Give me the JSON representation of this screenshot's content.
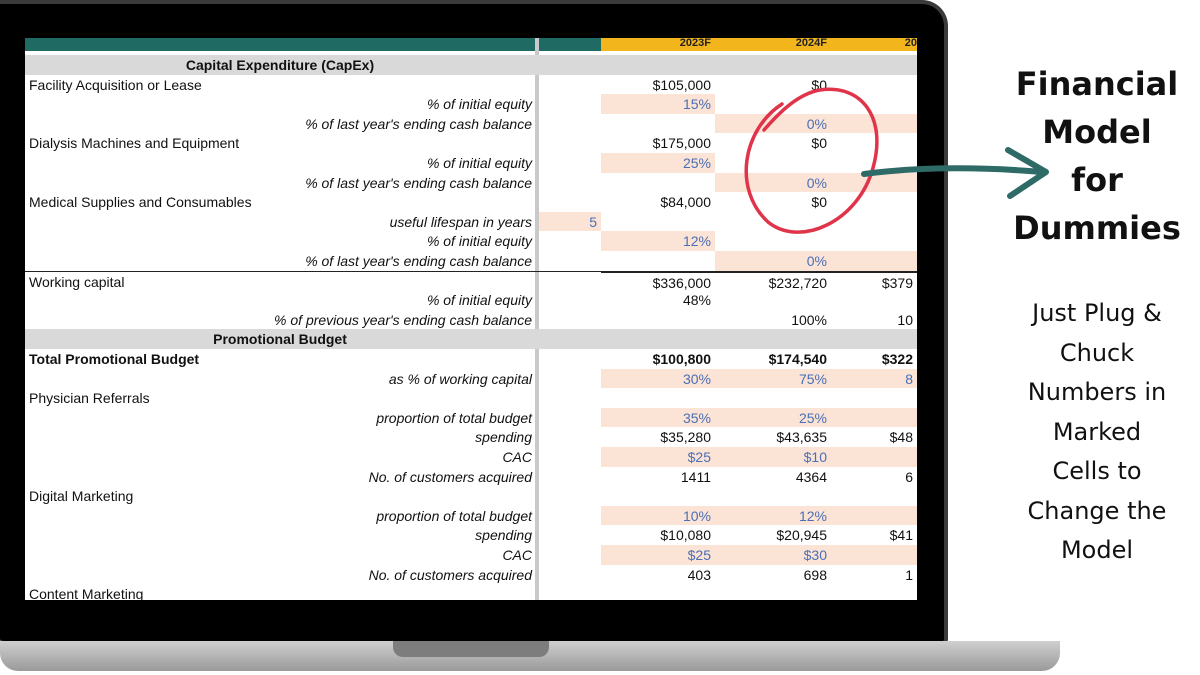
{
  "years": [
    "2023F",
    "2024F",
    "20"
  ],
  "rows": [
    {
      "type": "section",
      "label": "Capital Expenditure (CapEx)"
    },
    {
      "type": "main",
      "label": "Facility Acquisition or Lease",
      "v": [
        "$105,000",
        "$0",
        ""
      ]
    },
    {
      "type": "sub",
      "label": "% of initial equity",
      "v": [
        "15%",
        "",
        ""
      ],
      "inp": [
        true,
        false,
        false
      ]
    },
    {
      "type": "sub",
      "label": "% of last year's ending cash balance",
      "v": [
        "",
        "0%",
        ""
      ],
      "inp": [
        false,
        true,
        true
      ]
    },
    {
      "type": "main",
      "label": "Dialysis Machines and Equipment",
      "v": [
        "$175,000",
        "$0",
        ""
      ]
    },
    {
      "type": "sub",
      "label": "% of initial equity",
      "v": [
        "25%",
        "",
        ""
      ],
      "inp": [
        true,
        false,
        false
      ]
    },
    {
      "type": "sub",
      "label": "% of last year's ending cash balance",
      "v": [
        "",
        "0%",
        ""
      ],
      "inp": [
        false,
        true,
        true
      ]
    },
    {
      "type": "main",
      "label": "Medical Supplies and Consumables",
      "v": [
        "$84,000",
        "$0",
        ""
      ]
    },
    {
      "type": "sub",
      "label": "useful lifespan in years",
      "x": "5",
      "v": [
        "",
        "",
        ""
      ],
      "inp": [
        false,
        false,
        false
      ]
    },
    {
      "type": "sub",
      "label": "% of initial equity",
      "v": [
        "12%",
        "",
        ""
      ],
      "inp": [
        true,
        false,
        false
      ]
    },
    {
      "type": "sub",
      "label": "% of last year's ending cash balance",
      "v": [
        "",
        "0%",
        ""
      ],
      "inp": [
        false,
        true,
        true
      ]
    },
    {
      "type": "main",
      "label": "Working capital",
      "v": [
        "$336,000",
        "$232,720",
        "$379"
      ],
      "line": true
    },
    {
      "type": "sub",
      "label": "% of initial equity",
      "v": [
        "48%",
        "",
        ""
      ],
      "inp": [
        false,
        false,
        false
      ]
    },
    {
      "type": "sub",
      "label": "% of previous year's ending cash balance",
      "v": [
        "",
        "100%",
        "10"
      ],
      "inp": [
        false,
        false,
        false
      ]
    },
    {
      "type": "section",
      "label": "Promotional Budget"
    },
    {
      "type": "main",
      "bold": true,
      "label": "Total Promotional Budget",
      "v": [
        "$100,800",
        "$174,540",
        "$322"
      ]
    },
    {
      "type": "sub",
      "label": "as % of working capital",
      "v": [
        "30%",
        "75%",
        "8"
      ],
      "inp": [
        true,
        true,
        true
      ]
    },
    {
      "type": "main",
      "label": "Physician Referrals",
      "v": [
        "",
        "",
        ""
      ]
    },
    {
      "type": "sub",
      "label": "proportion of total budget",
      "v": [
        "35%",
        "25%",
        ""
      ],
      "inp": [
        true,
        true,
        true
      ]
    },
    {
      "type": "sub",
      "label": "spending",
      "v": [
        "$35,280",
        "$43,635",
        "$48"
      ],
      "inp": [
        false,
        false,
        false
      ]
    },
    {
      "type": "sub",
      "label": "CAC",
      "v": [
        "$25",
        "$10",
        ""
      ],
      "inp": [
        true,
        true,
        true
      ]
    },
    {
      "type": "sub",
      "label": "No. of customers acquired",
      "v": [
        "1411",
        "4364",
        "6"
      ],
      "inp": [
        false,
        false,
        false
      ]
    },
    {
      "type": "main",
      "label": "Digital Marketing",
      "v": [
        "",
        "",
        ""
      ]
    },
    {
      "type": "sub",
      "label": "proportion of total budget",
      "v": [
        "10%",
        "12%",
        ""
      ],
      "inp": [
        true,
        true,
        true
      ]
    },
    {
      "type": "sub",
      "label": "spending",
      "v": [
        "$10,080",
        "$20,945",
        "$41"
      ],
      "inp": [
        false,
        false,
        false
      ]
    },
    {
      "type": "sub",
      "label": "CAC",
      "v": [
        "$25",
        "$30",
        ""
      ],
      "inp": [
        true,
        true,
        true
      ]
    },
    {
      "type": "sub",
      "label": "No. of customers acquired",
      "v": [
        "403",
        "698",
        "1"
      ],
      "inp": [
        false,
        false,
        false
      ]
    },
    {
      "type": "main",
      "label": "Content Marketing",
      "v": [
        "",
        "",
        ""
      ]
    }
  ],
  "side": {
    "title_lines": [
      "Financial",
      "Model",
      "for",
      "Dummies"
    ],
    "sub_lines": [
      "Just Plug &",
      "Chuck",
      "Numbers in",
      "Marked",
      "Cells to",
      "Change the",
      "Model"
    ]
  },
  "colors": {
    "teal_header": "#1f6b63",
    "gold_header": "#f2b51c",
    "input_fill": "#fbe3d6",
    "input_text": "#4a6fb5",
    "circle": "#e0344a",
    "arrow": "#2e6a66"
  }
}
